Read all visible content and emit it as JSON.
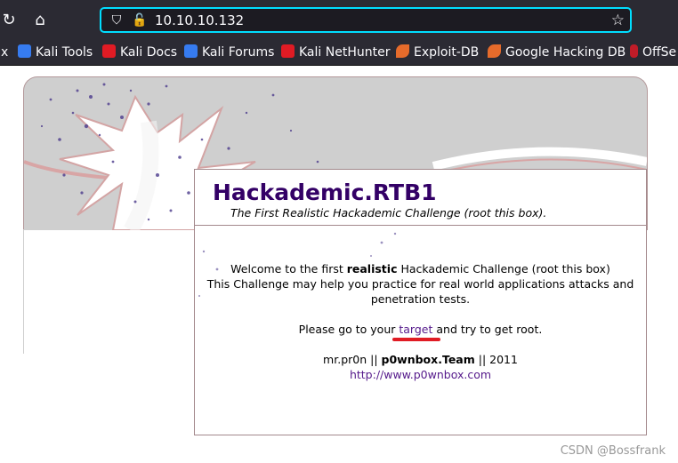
{
  "browser": {
    "url": "10.10.10.132",
    "bookmarks": [
      {
        "label": "x",
        "icon": "truncated-icon",
        "color": "#2b2a33"
      },
      {
        "label": "Kali Tools",
        "icon": "kali-tools-icon",
        "color": "#367bf0"
      },
      {
        "label": "Kali Docs",
        "icon": "kali-docs-icon",
        "color": "#e01b24"
      },
      {
        "label": "Kali Forums",
        "icon": "kali-forums-icon",
        "color": "#367bf0"
      },
      {
        "label": "Kali NetHunter",
        "icon": "kali-nethunter-icon",
        "color": "#e01b24"
      },
      {
        "label": "Exploit-DB",
        "icon": "exploit-db-icon",
        "color": "#e66b2b"
      },
      {
        "label": "Google Hacking DB",
        "icon": "google-hacking-db-icon",
        "color": "#e66b2b"
      },
      {
        "label": "OffSe",
        "icon": "offsec-icon",
        "color": "#c01c28"
      }
    ]
  },
  "page": {
    "title": "Hackademic.RTB1",
    "subtitle": "The First Realistic Hackademic Challenge (root this box).",
    "welcome_pre": "Welcome to the first ",
    "welcome_bold": "realistic",
    "welcome_post": " Hackademic Challenge (root this box)",
    "line2": "This Challenge may help you practice for real world applications attacks and",
    "line3": "penetration tests.",
    "goto_pre": "Please go to your ",
    "goto_link": "target",
    "goto_post": " and try to get root.",
    "author": "mr.pr0n || ",
    "team": "p0wnbox.Team",
    "year": " || 2011",
    "site": "http://www.p0wnbox.com"
  },
  "watermark": "CSDN @Bossfrank",
  "colors": {
    "title": "#330066",
    "link": "#551a8b",
    "highlight": "#e01b24",
    "urlbar_focus": "#00ddff"
  }
}
